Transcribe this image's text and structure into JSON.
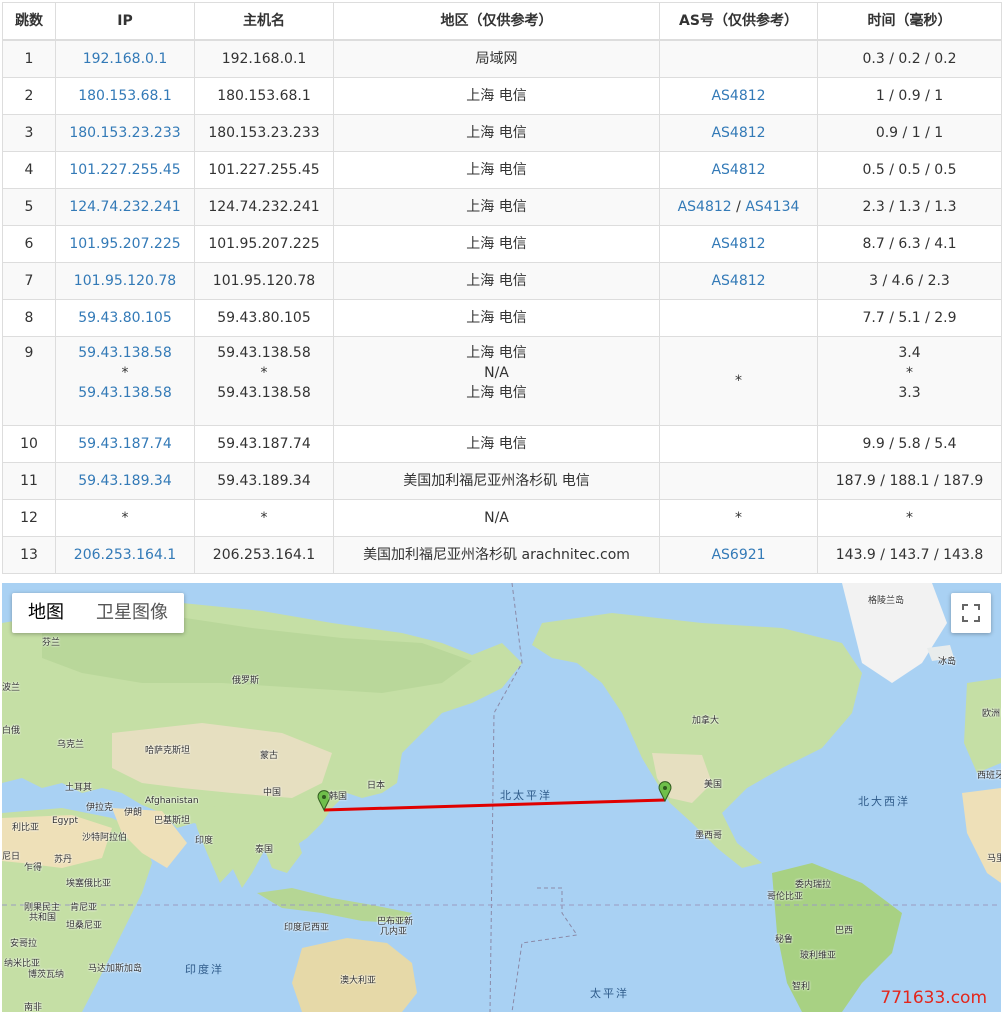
{
  "table": {
    "headers": [
      "跳数",
      "IP",
      "主机名",
      "地区（仅供参考）",
      "AS号（仅供参考）",
      "时间（毫秒）"
    ],
    "rows": [
      {
        "hop": "1",
        "ip": "192.168.0.1",
        "host": "192.168.0.1",
        "region": "局域网",
        "as": "",
        "time": "0.3 / 0.2 / 0.2"
      },
      {
        "hop": "2",
        "ip": "180.153.68.1",
        "host": "180.153.68.1",
        "region": "上海 电信",
        "as": "AS4812",
        "time": "1 / 0.9 / 1"
      },
      {
        "hop": "3",
        "ip": "180.153.23.233",
        "host": "180.153.23.233",
        "region": "上海 电信",
        "as": "AS4812",
        "time": "0.9 / 1 / 1"
      },
      {
        "hop": "4",
        "ip": "101.227.255.45",
        "host": "101.227.255.45",
        "region": "上海 电信",
        "as": "AS4812",
        "time": "0.5 / 0.5 / 0.5"
      },
      {
        "hop": "5",
        "ip": "124.74.232.241",
        "host": "124.74.232.241",
        "region": "上海 电信",
        "as": "AS4812",
        "as2": "AS4134",
        "as_sep": "/",
        "time": "2.3 / 1.3 / 1.3"
      },
      {
        "hop": "6",
        "ip": "101.95.207.225",
        "host": "101.95.207.225",
        "region": "上海 电信",
        "as": "AS4812",
        "time": "8.7 / 6.3 / 4.1"
      },
      {
        "hop": "7",
        "ip": "101.95.120.78",
        "host": "101.95.120.78",
        "region": "上海 电信",
        "as": "AS4812",
        "time": "3 / 4.6 / 2.3"
      },
      {
        "hop": "8",
        "ip": "59.43.80.105",
        "host": "59.43.80.105",
        "region": "上海 电信",
        "as": "",
        "time": "7.7 / 5.1 / 2.9"
      },
      {
        "hop": "9",
        "ip_lines": [
          "59.43.138.58",
          "*",
          "59.43.138.58"
        ],
        "host_lines": [
          "59.43.138.58",
          "*",
          "59.43.138.58"
        ],
        "region_lines": [
          "上海 电信",
          "N/A",
          "上海 电信"
        ],
        "as": "*",
        "time_lines": [
          "3.4",
          "*",
          "3.3"
        ]
      },
      {
        "hop": "10",
        "ip": "59.43.187.74",
        "host": "59.43.187.74",
        "region": "上海 电信",
        "as": "",
        "time": "9.9 / 5.8 / 5.4"
      },
      {
        "hop": "11",
        "ip": "59.43.189.34",
        "host": "59.43.189.34",
        "region": "美国加利福尼亚州洛杉矶 电信",
        "as": "",
        "time": "187.9 / 188.1 / 187.9"
      },
      {
        "hop": "12",
        "ip": "*",
        "host": "*",
        "region": "N/A",
        "as": "*",
        "time": "*"
      },
      {
        "hop": "13",
        "ip": "206.253.164.1",
        "host": "206.253.164.1",
        "region": "美国加利福尼亚州洛杉矶 arachnitec.com",
        "as": "AS6921",
        "time": "143.9 / 143.7 / 143.8"
      }
    ]
  },
  "map": {
    "type_buttons": {
      "map": "地图",
      "satellite": "卫星图像"
    },
    "fullscreen_icon": "fullscreen-icon",
    "route_color": "#e00000",
    "marker_color": "#6fbf4a",
    "oceans": {
      "north_pacific": "北太平洋",
      "north_atlantic": "北大西洋",
      "indian": "印度洋",
      "pacific": "太平洋"
    },
    "labels": {
      "greenland": "格陵兰岛",
      "iceland": "冰岛",
      "finland": "芬兰",
      "russia": "俄罗斯",
      "canada": "加拿大",
      "ukraine": "乌克兰",
      "kazakhstan": "哈萨克斯坦",
      "mongolia": "蒙古",
      "china": "中国",
      "japan": "日本",
      "korea": "韩国",
      "usa": "美国",
      "turkey": "土耳其",
      "iraq": "伊拉克",
      "iran": "伊朗",
      "afghanistan": "Afghanistan",
      "pakistan": "巴基斯坦",
      "india": "印度",
      "thailand": "泰国",
      "egypt": "Egypt",
      "libya": "利比亚",
      "saudi": "沙特阿拉伯",
      "sudan": "苏丹",
      "chad": "乍得",
      "niger": "尼日",
      "ethiopia": "埃塞俄比亚",
      "kenya": "肯尼亚",
      "drc_a": "刚果民主",
      "drc_b": "共和国",
      "tanzania": "坦桑尼亚",
      "angola": "安哥拉",
      "namibia": "纳米比亚",
      "botswana": "博茨瓦纳",
      "madagascar": "马达加斯加岛",
      "south_africa": "南非",
      "indonesia": "印度尼西亚",
      "png_a": "巴布亚新",
      "png_b": "几内亚",
      "australia": "澳大利亚",
      "mexico": "墨西哥",
      "venezuela": "委内瑞拉",
      "colombia": "哥伦比亚",
      "peru": "秘鲁",
      "brazil": "巴西",
      "bolivia": "玻利维亚",
      "chile": "智利",
      "poland": "波兰",
      "spain": "西班牙",
      "mali": "马里",
      "belarus": "白俄",
      "europe": "欧洲"
    },
    "watermark": "771633.com"
  }
}
